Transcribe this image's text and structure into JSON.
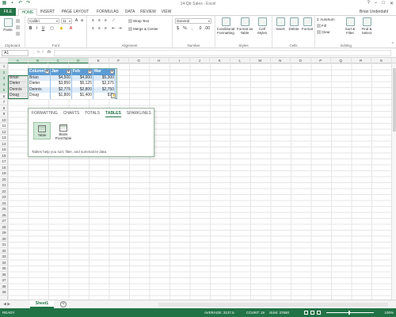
{
  "title": "14-Qtr Sales - Excel",
  "user": "Brian Underdahl",
  "ribbon_tabs": [
    "FILE",
    "HOME",
    "INSERT",
    "PAGE LAYOUT",
    "FORMULAS",
    "DATA",
    "REVIEW",
    "VIEW"
  ],
  "clipboard": {
    "paste": "Paste",
    "label": "Clipboard"
  },
  "font": {
    "name": "Calibri",
    "size": "11",
    "label": "Font"
  },
  "alignment": {
    "wrap": "Wrap Text",
    "merge": "Merge & Center",
    "label": "Alignment"
  },
  "number": {
    "format": "General",
    "label": "Number"
  },
  "styles": {
    "conditional": "Conditional Formatting",
    "format_table": "Format as Table",
    "cell_styles": "Cell Styles",
    "label": "Styles"
  },
  "cells_grp": {
    "insert": "Insert",
    "delete": "Delete",
    "format": "Format",
    "label": "Cells"
  },
  "editing": {
    "autosum": "AutoSum",
    "fill": "Fill",
    "clear": "Clear",
    "sort": "Sort & Filter",
    "find": "Find & Select",
    "label": "Editing"
  },
  "formula_bar": {
    "namebox": "A1",
    "fx": "fx",
    "value": ""
  },
  "columns": [
    "A",
    "B",
    "C",
    "D",
    "E",
    "F",
    "G",
    "H",
    "I",
    "J",
    "K",
    "L",
    "M",
    "N",
    "O",
    "P",
    "Q",
    "R",
    "S"
  ],
  "rows": [
    "1",
    "2",
    "3",
    "4",
    "5",
    "6",
    "7",
    "8",
    "9",
    "10",
    "11",
    "12",
    "13",
    "14",
    "15",
    "16",
    "17",
    "18",
    "19",
    "20",
    "21",
    "22",
    "23",
    "24",
    "25",
    "26",
    "27",
    "28",
    "29",
    "30",
    "31",
    "32",
    "33",
    "34",
    "35",
    "36",
    "37",
    "38",
    "39"
  ],
  "col_a_names": [
    "Brian",
    "Dieter",
    "Dennis",
    "Doug"
  ],
  "table": {
    "headers": [
      "Column1",
      "Jan",
      "Feb",
      "Mar"
    ],
    "rows": [
      [
        "Brian",
        "$4,500",
        "$4,900",
        "$5,300"
      ],
      [
        "Dieter",
        "$3,850",
        "$5,125",
        "$2,375"
      ],
      [
        "Dennis",
        "$2,775",
        "$2,800",
        "$2,750"
      ],
      [
        "Doug",
        "$1,800",
        "$1,400",
        "$75"
      ]
    ]
  },
  "quick_analysis": {
    "tabs": [
      "FORMATTING",
      "CHARTS",
      "TOTALS",
      "TABLES",
      "SPARKLINES"
    ],
    "active_tab": "TABLES",
    "items": [
      "Table",
      "Blank PivotTable"
    ],
    "description": "Tables help you sort, filter, and summarize data."
  },
  "sheet": {
    "name": "Sheet1",
    "add": "+"
  },
  "status": {
    "ready": "READY",
    "average": "AVERAGE: 3137.5",
    "count": "COUNT: 19",
    "sum": "SUM: 37650",
    "zoom": "100%"
  }
}
